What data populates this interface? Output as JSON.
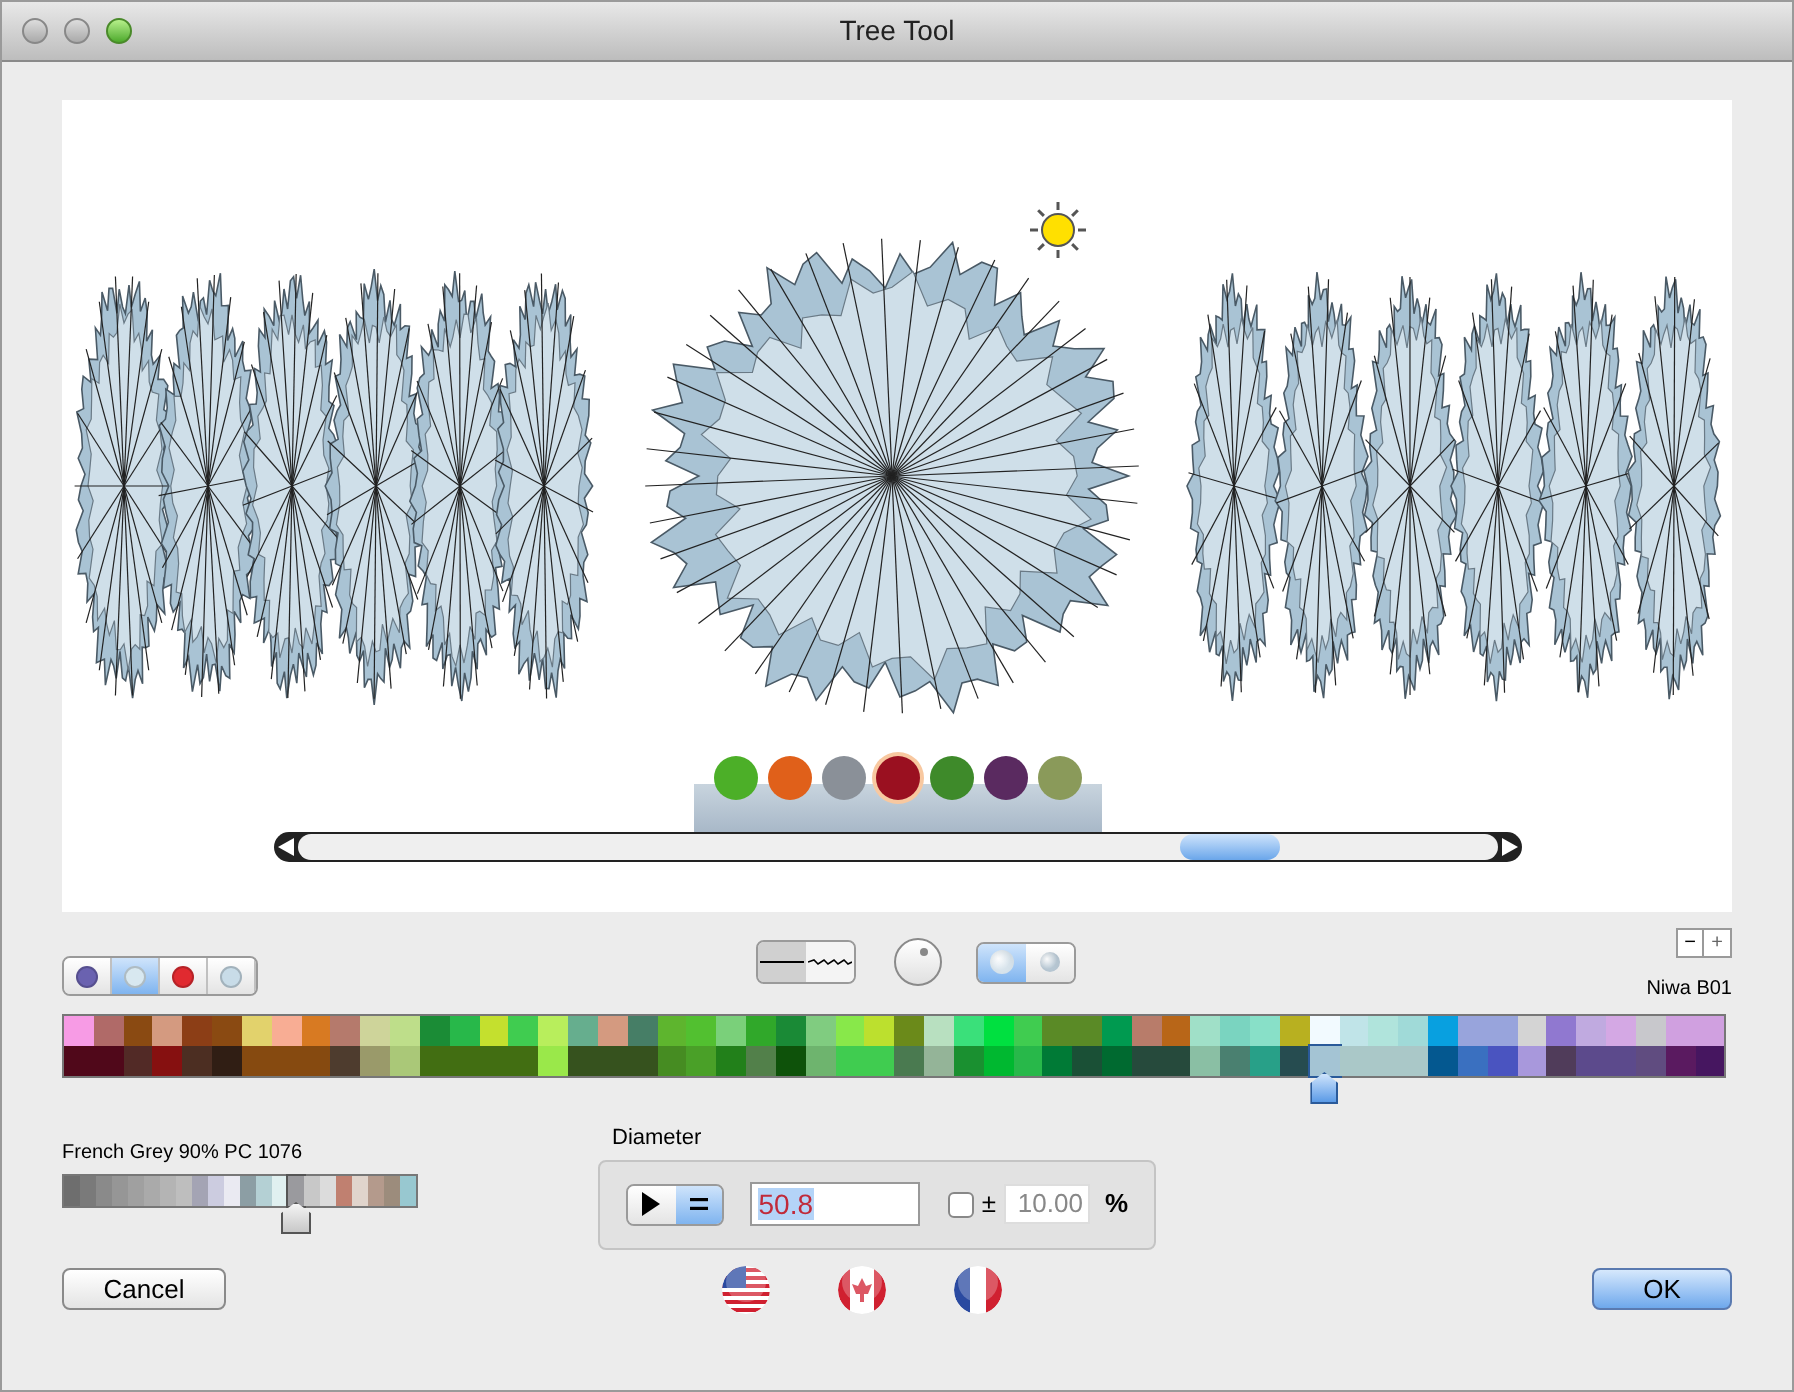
{
  "window": {
    "title": "Tree Tool"
  },
  "preview": {
    "thumbnails": [
      {
        "color": "#4caf28",
        "selected": false
      },
      {
        "color": "#e0601a",
        "selected": false
      },
      {
        "color": "#8a9098",
        "selected": false
      },
      {
        "color": "#9a1020",
        "selected": true
      },
      {
        "color": "#3e8a2a",
        "selected": false
      },
      {
        "color": "#5a2a60",
        "selected": false
      },
      {
        "color": "#8a9a5a",
        "selected": false
      }
    ]
  },
  "style_buttons": [
    {
      "color": "#6a62b0",
      "selected": false
    },
    {
      "color": "#d8e8f0",
      "selected": true
    },
    {
      "color": "#e02a30",
      "selected": false
    },
    {
      "color": "#c8dce8",
      "selected": false
    }
  ],
  "line_style": [
    {
      "kind": "solid",
      "selected": true
    },
    {
      "kind": "wavy",
      "selected": false
    }
  ],
  "view_toggle": [
    {
      "kind": "flat",
      "selected": true
    },
    {
      "kind": "tilted",
      "selected": false
    }
  ],
  "zoom_buttons": [
    "−",
    "+"
  ],
  "palette_name": "Niwa B01",
  "palette": {
    "top_row": [
      {
        "color": "#f79be5"
      },
      {
        "color": "#b06a68"
      },
      {
        "color": "#8a4a12"
      },
      {
        "color": "#d49a80"
      },
      {
        "color": "#8c3e16"
      },
      {
        "color": "#8a4a12"
      },
      {
        "color": "#e2d26c"
      },
      {
        "color": "#f8ad94"
      },
      {
        "color": "#d87a22"
      },
      {
        "color": "#b57a6c"
      },
      {
        "color": "#ced49a"
      },
      {
        "color": "#bede8a"
      },
      {
        "color": "#1b8c36"
      },
      {
        "color": "#28b84a"
      },
      {
        "color": "#c4e02e"
      },
      {
        "color": "#40cc50"
      },
      {
        "color": "#b8ee5c"
      },
      {
        "color": "#66ae8e"
      },
      {
        "color": "#d49a80"
      },
      {
        "color": "#467e66"
      },
      {
        "color": "#5eb52e"
      },
      {
        "color": "#52c030"
      },
      {
        "color": "#7ad07a"
      },
      {
        "color": "#30a82a"
      },
      {
        "color": "#1a8a36"
      },
      {
        "color": "#80cc80"
      },
      {
        "color": "#88e84a"
      },
      {
        "color": "#bce02e"
      },
      {
        "color": "#6b8a1a"
      },
      {
        "color": "#b8e0c0"
      },
      {
        "color": "#3ae07a"
      },
      {
        "color": "#00e040"
      },
      {
        "color": "#40cc50"
      },
      {
        "color": "#5a8a26"
      },
      {
        "color": "#5a8a26"
      },
      {
        "color": "#009a50"
      },
      {
        "color": "#b87c6a"
      },
      {
        "color": "#b86618"
      },
      {
        "color": "#a0e0c8"
      },
      {
        "color": "#7ad4c0"
      },
      {
        "color": "#88e0c8"
      },
      {
        "color": "#b8b020"
      },
      {
        "color": "#f2faff"
      },
      {
        "color": "#c0e4e8"
      },
      {
        "color": "#b0e4dc"
      },
      {
        "color": "#a0dad8"
      },
      {
        "color": "#08a0e0"
      },
      {
        "color": "#98a4dc"
      },
      {
        "color": "#98a4dc"
      },
      {
        "color": "#d4d4d4"
      },
      {
        "color": "#9078d0"
      },
      {
        "color": "#c0aae0"
      },
      {
        "color": "#d4a8e4"
      },
      {
        "color": "#c8c8cc"
      },
      {
        "color": "#d0a0e0"
      },
      {
        "color": "#d0a0e0"
      }
    ],
    "bottom_row": [
      {
        "color": "#50081a",
        "selected": false
      },
      {
        "color": "#50081a",
        "selected": false
      },
      {
        "color": "#522a26",
        "selected": false
      },
      {
        "color": "#861010",
        "selected": false
      },
      {
        "color": "#4c2e22",
        "selected": false
      },
      {
        "color": "#301e14",
        "selected": false
      },
      {
        "color": "#864a10",
        "selected": false
      },
      {
        "color": "#864a10",
        "selected": false
      },
      {
        "color": "#864a10",
        "selected": false
      },
      {
        "color": "#4e3c2e",
        "selected": false
      },
      {
        "color": "#9a9a6a",
        "selected": false
      },
      {
        "color": "#aac878",
        "selected": false
      },
      {
        "color": "#426e12",
        "selected": false
      },
      {
        "color": "#426e12",
        "selected": false
      },
      {
        "color": "#426e12",
        "selected": false
      },
      {
        "color": "#426e12",
        "selected": false
      },
      {
        "color": "#9ae84a",
        "selected": false
      },
      {
        "color": "#36521e",
        "selected": false
      },
      {
        "color": "#36521e",
        "selected": false
      },
      {
        "color": "#36521e",
        "selected": false
      },
      {
        "color": "#468c22",
        "selected": false
      },
      {
        "color": "#4aa028",
        "selected": false
      },
      {
        "color": "#22801a",
        "selected": false
      },
      {
        "color": "#52804a",
        "selected": false
      },
      {
        "color": "#0e520a",
        "selected": false
      },
      {
        "color": "#6eb46e",
        "selected": false
      },
      {
        "color": "#40cc50",
        "selected": false
      },
      {
        "color": "#40cc50",
        "selected": false
      },
      {
        "color": "#4a7a50",
        "selected": false
      },
      {
        "color": "#94b498",
        "selected": false
      },
      {
        "color": "#1a9030",
        "selected": false
      },
      {
        "color": "#00b830",
        "selected": false
      },
      {
        "color": "#28b84a",
        "selected": false
      },
      {
        "color": "#007a36",
        "selected": false
      },
      {
        "color": "#1a5036",
        "selected": false
      },
      {
        "color": "#006a30",
        "selected": false
      },
      {
        "color": "#264a3c",
        "selected": false
      },
      {
        "color": "#264a3c",
        "selected": false
      },
      {
        "color": "#8abfa4",
        "selected": false
      },
      {
        "color": "#4a8070",
        "selected": false
      },
      {
        "color": "#28a088",
        "selected": false
      },
      {
        "color": "#264c50",
        "selected": false
      },
      {
        "color": "#a4c4d4",
        "selected": true
      },
      {
        "color": "#aac8c8",
        "selected": false
      },
      {
        "color": "#aac8c8",
        "selected": false
      },
      {
        "color": "#aac8c8",
        "selected": false
      },
      {
        "color": "#045890",
        "selected": false
      },
      {
        "color": "#3a70c0",
        "selected": false
      },
      {
        "color": "#4a54c0",
        "selected": false
      },
      {
        "color": "#a898dc",
        "selected": false
      },
      {
        "color": "#503c5a",
        "selected": false
      },
      {
        "color": "#5c4a8c",
        "selected": false
      },
      {
        "color": "#5c4a8c",
        "selected": false
      },
      {
        "color": "#604c80",
        "selected": false
      },
      {
        "color": "#5a1a60",
        "selected": false
      },
      {
        "color": "#461660",
        "selected": false
      }
    ]
  },
  "outline_name": "French Grey 90% PC 1076",
  "outline_palette": [
    {
      "color": "#6e6e6e",
      "selected": false
    },
    {
      "color": "#7a7a7a",
      "selected": false
    },
    {
      "color": "#8a8a8a",
      "selected": false
    },
    {
      "color": "#969696",
      "selected": false
    },
    {
      "color": "#a0a0a0",
      "selected": false
    },
    {
      "color": "#aaaaaa",
      "selected": false
    },
    {
      "color": "#b4b4b4",
      "selected": false
    },
    {
      "color": "#bebebe",
      "selected": false
    },
    {
      "color": "#a4a4b4",
      "selected": false
    },
    {
      "color": "#cccce0",
      "selected": false
    },
    {
      "color": "#eaeaf2",
      "selected": false
    },
    {
      "color": "#8c9ea4",
      "selected": false
    },
    {
      "color": "#b4d0d4",
      "selected": false
    },
    {
      "color": "#e0f0f0",
      "selected": false
    },
    {
      "color": "#9a9a9e",
      "selected": true
    },
    {
      "color": "#c8c8c8",
      "selected": false
    },
    {
      "color": "#dcdcdc",
      "selected": false
    },
    {
      "color": "#c08070",
      "selected": false
    },
    {
      "color": "#e0d4cc",
      "selected": false
    },
    {
      "color": "#b49a8c",
      "selected": false
    },
    {
      "color": "#9c8c7c",
      "selected": false
    },
    {
      "color": "#98c8d0",
      "selected": false
    }
  ],
  "diameter": {
    "title": "Diameter",
    "modes": [
      {
        "kind": "pointer",
        "selected": false
      },
      {
        "kind": "equals",
        "selected": true
      }
    ],
    "value": "50.8",
    "vary": {
      "checked": false,
      "label": "±",
      "value": "10.00",
      "unit": "%"
    }
  },
  "flags": [
    {
      "kind": "us"
    },
    {
      "kind": "canada"
    },
    {
      "kind": "france"
    }
  ],
  "buttons": [
    {
      "label": "Cancel",
      "default": false
    },
    {
      "label": "OK",
      "default": true
    }
  ]
}
